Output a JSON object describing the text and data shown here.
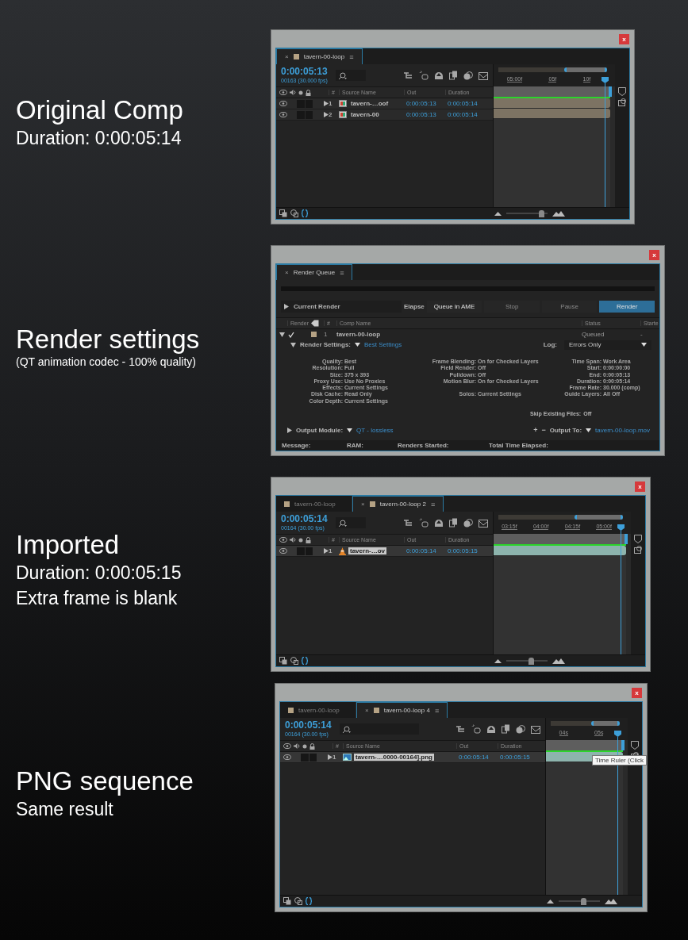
{
  "sections": [
    {
      "kind": "timeline",
      "caption": {
        "title": "Original Comp",
        "lines": [
          {
            "kind": "detail",
            "text": "Duration: 0:00:05:14"
          }
        ]
      },
      "window": {
        "close": "x",
        "tabs": [
          {
            "label": "tavern-00-loop",
            "selected": true,
            "close": "×",
            "menu": "≡"
          }
        ],
        "timecode": "0:00:05:13",
        "frames": "00163 (30.000 fps)",
        "columns": {
          "number": "#",
          "source": "Source Name",
          "out": "Out",
          "duration": "Duration"
        },
        "ruler": [
          "05:00f",
          "05f",
          "10f"
        ],
        "layers": [
          {
            "number": "1",
            "kind": "comp",
            "name": "tavern-…oof",
            "out": "0:00:05:13",
            "duration": "0:00:05:14",
            "selected": false,
            "color": "#7d7363"
          },
          {
            "number": "2",
            "kind": "comp",
            "name": "tavern-00",
            "out": "0:00:05:13",
            "duration": "0:00:05:14",
            "selected": false,
            "color": "#7d7363"
          }
        ],
        "zoom": {
          "level": 0.85
        }
      }
    },
    {
      "kind": "render_queue",
      "caption": {
        "title": "Render settings",
        "lines": [
          {
            "kind": "note",
            "text": "(QT animation codec - 100% quality)"
          }
        ]
      },
      "window": {
        "close": "x",
        "tab": {
          "label": "Render Queue",
          "close": "×",
          "menu": "≡"
        },
        "progress": {
          "level": 0
        },
        "current_render": "Current Render",
        "elapsed": "Elapse",
        "buttons": [
          {
            "label": "Queue in AME",
            "kind": "normal",
            "disabled": false
          },
          {
            "label": "Stop",
            "kind": "normal",
            "disabled": true
          },
          {
            "label": "Pause",
            "kind": "normal",
            "disabled": true
          },
          {
            "label": "Render",
            "kind": "primary",
            "disabled": false
          }
        ],
        "columns": {
          "render": "Render",
          "number": "#",
          "comp": "Comp Name",
          "status": "Status",
          "started": "Starte"
        },
        "item": {
          "checked": true,
          "number": "1",
          "name": "tavern-00-loop",
          "status": "Queued",
          "started": "-"
        },
        "render_settings": {
          "label": "Render Settings:",
          "value": "Best Settings"
        },
        "log": {
          "label": "Log:",
          "value": "Errors Only"
        },
        "settings": [
          [
            {
              "label": "Quality:",
              "value": "Best"
            },
            {
              "label": "Resolution:",
              "value": "Full"
            },
            {
              "label": "Size:",
              "value": "375 x 393"
            },
            {
              "label": "Proxy Use:",
              "value": "Use No Proxies"
            },
            {
              "label": "Effects:",
              "value": "Current  Settings"
            },
            {
              "label": "Disk Cache:",
              "value": "Read Only"
            },
            {
              "label": "Color Depth:",
              "value": "Current Settings"
            }
          ],
          [
            {
              "label": "Frame Blending:",
              "value": "On for Checked Layers"
            },
            {
              "label": "Field Render:",
              "value": "Off"
            },
            {
              "label": "Pulldown:",
              "value": "Off"
            },
            {
              "label": "Motion Blur:",
              "value": "On for Checked Layers"
            },
            {
              "label": "Solos:",
              "value": "Current  Settings",
              "spaced": true
            }
          ],
          [
            {
              "label": "Time Span:",
              "value": "Work Area"
            },
            {
              "label": "Start:",
              "value": "0:00:00:00"
            },
            {
              "label": "End:",
              "value": "0:00:05:13"
            },
            {
              "label": "Duration:",
              "value": "0:00:05:14"
            },
            {
              "label": "Frame Rate:",
              "value": "30.000 (comp)"
            },
            {
              "label": "Guide Layers:",
              "value": "All Off"
            }
          ]
        ],
        "skip": {
          "label": "Skip Existing Files:",
          "value": "Off"
        },
        "output_module": {
          "label": "Output Module:",
          "value": "QT - lossless"
        },
        "add": "+",
        "remove": "−",
        "output_to": {
          "label": "Output To:",
          "value": "tavern-00-loop.mov"
        },
        "status_bar": [
          "Message:",
          "RAM:",
          "Renders Started:",
          "Total Time Elapsed:"
        ]
      }
    },
    {
      "kind": "timeline",
      "caption": {
        "title": "Imported",
        "lines": [
          {
            "kind": "detail",
            "text": "Duration: 0:00:05:15"
          },
          {
            "kind": "detail",
            "text": "Extra frame is blank"
          }
        ]
      },
      "window": {
        "close": "x",
        "tabs": [
          {
            "label": "tavern-00-loop",
            "selected": false
          },
          {
            "label": "tavern-00-loop 2",
            "selected": true,
            "close": "×",
            "menu": "≡"
          }
        ],
        "timecode": "0:00:05:14",
        "frames": "00164 (30.00 fps)",
        "columns": {
          "number": "#",
          "source": "Source Name",
          "out": "Out",
          "duration": "Duration"
        },
        "ruler": [
          "03:15f",
          "04:00f",
          "04:15f",
          "05:00f"
        ],
        "layers": [
          {
            "number": "1",
            "kind": "movie",
            "name": "tavern-…ov",
            "out": "0:00:05:14",
            "duration": "0:00:05:15",
            "selected": true,
            "color": "#8db4ad"
          }
        ],
        "zoom": {
          "level": 0.6
        }
      }
    },
    {
      "kind": "timeline",
      "caption": {
        "title": "PNG sequence",
        "lines": [
          {
            "kind": "detail",
            "text": "Same result"
          }
        ]
      },
      "window": {
        "close": "x",
        "tabs": [
          {
            "label": "tavern-00-loop",
            "selected": false
          },
          {
            "label": "tavern-00-loop 4",
            "selected": true,
            "close": "×",
            "menu": "≡"
          }
        ],
        "timecode": "0:00:05:14",
        "frames": "00164 (30.00 fps)",
        "columns": {
          "number": "#",
          "source": "Source Name",
          "out": "Out",
          "duration": "Duration"
        },
        "ruler": [
          "04s",
          "05s"
        ],
        "layers": [
          {
            "number": "1",
            "kind": "image",
            "name": "tavern-…0000-00164].png",
            "out": "0:00:05:14",
            "duration": "0:00:05:15",
            "selected": true,
            "color": "#8db4ad"
          }
        ],
        "zoom": {
          "level": 0.6
        },
        "tooltip": "Time Ruler (Click"
      }
    }
  ]
}
